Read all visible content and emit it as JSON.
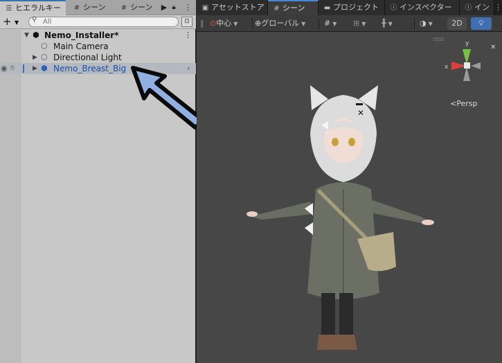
{
  "hierarchy": {
    "tabs": {
      "hierarchy": "ヒエラルキー",
      "scene1": "シーン",
      "scene2": "シーン"
    },
    "toolbar": {
      "add": "+",
      "search_placeholder": "All"
    },
    "rows": {
      "root": "Nemo_Installer*",
      "camera": "Main Camera",
      "light": "Directional Light",
      "selected": "Nemo_Breast_Big"
    }
  },
  "scene": {
    "tabs": {
      "asset_store": "アセットストア",
      "scene": "シーン",
      "project": "プロジェクト",
      "inspector": "インスペクター",
      "inspector2": "イン"
    },
    "toolbar": {
      "pivot": "中心",
      "global": "グローバル",
      "mode_2d": "2D"
    },
    "view": {
      "projection": "Persp",
      "gizmo_y": "y",
      "gizmo_x": "x"
    }
  },
  "colors": {
    "selection_text": "#1d4fa3",
    "callout_fill": "#8fb0e0",
    "tab_accent": "#4a86d8",
    "gizmo_y": "#79c23f",
    "gizmo_x": "#d9413c"
  }
}
